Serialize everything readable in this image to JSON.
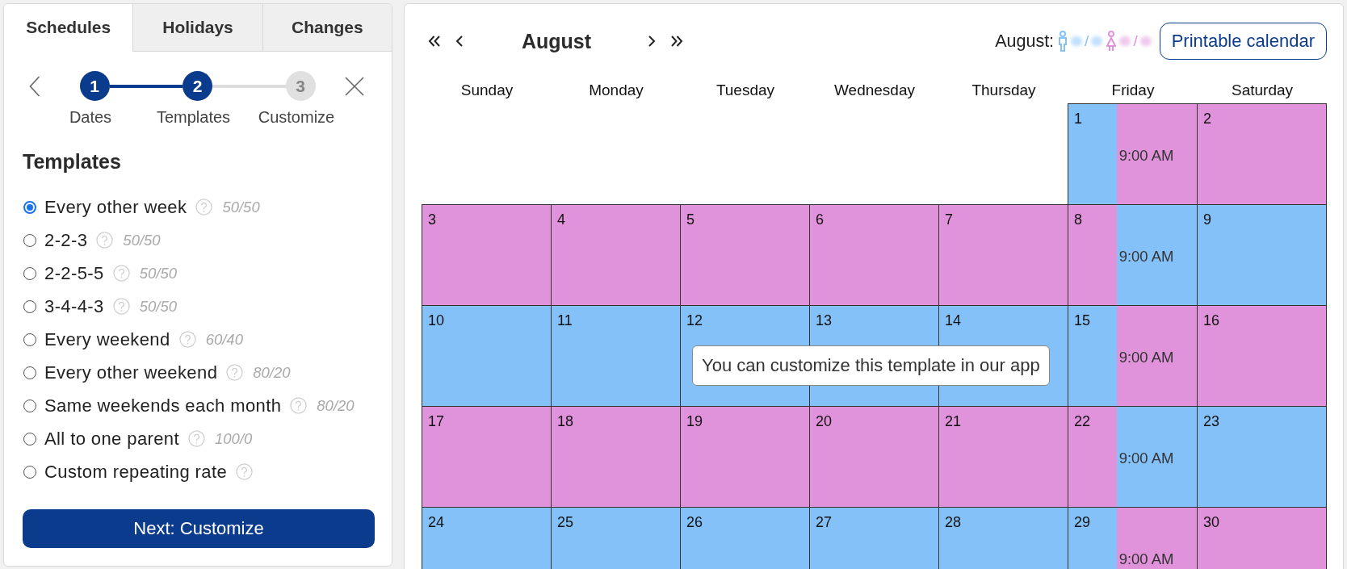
{
  "tabs": [
    {
      "label": "Schedules",
      "selected": true
    },
    {
      "label": "Holidays",
      "selected": false
    },
    {
      "label": "Changes",
      "selected": false
    }
  ],
  "stepper": {
    "steps": [
      {
        "number": "1",
        "label": "Dates",
        "reached": true
      },
      {
        "number": "2",
        "label": "Templates",
        "reached": true
      },
      {
        "number": "3",
        "label": "Customize",
        "reached": false
      }
    ]
  },
  "templates": {
    "title": "Templates",
    "options": [
      {
        "label": "Every other week",
        "ratio": "50/50",
        "selected": true
      },
      {
        "label": "2-2-3",
        "ratio": "50/50",
        "selected": false
      },
      {
        "label": "2-2-5-5",
        "ratio": "50/50",
        "selected": false
      },
      {
        "label": "3-4-4-3",
        "ratio": "50/50",
        "selected": false
      },
      {
        "label": "Every weekend",
        "ratio": "60/40",
        "selected": false
      },
      {
        "label": "Every other weekend",
        "ratio": "80/20",
        "selected": false
      },
      {
        "label": "Same weekends each month",
        "ratio": "80/20",
        "selected": false
      },
      {
        "label": "All to one parent",
        "ratio": "100/0",
        "selected": false
      },
      {
        "label": "Custom repeating rate",
        "selected": false
      }
    ]
  },
  "next_button": {
    "label": "Next: Customize"
  },
  "calendar": {
    "month": "August",
    "summary": {
      "label": "August:",
      "parents": [
        {
          "kind": "male",
          "color": "#85c1f9",
          "separator": "/"
        },
        {
          "kind": "female",
          "color": "#e093db",
          "separator": "/"
        }
      ]
    },
    "print_button": {
      "label": "Printable calendar"
    },
    "weekdays": [
      "Sunday",
      "Monday",
      "Tuesday",
      "Wednesday",
      "Thursday",
      "Friday",
      "Saturday"
    ],
    "weeks": [
      {
        "days": [
          {
            "kind": "blank"
          },
          {
            "kind": "blank"
          },
          {
            "kind": "blank"
          },
          {
            "kind": "blank"
          },
          {
            "kind": "blank"
          },
          {
            "kind": "handover",
            "date": "1",
            "parts": [
              {
                "color": "#85c1f9"
              },
              {
                "color": "#e093db",
                "time": "9:00 AM"
              }
            ]
          },
          {
            "kind": "day",
            "date": "2",
            "color": "#e093db"
          }
        ]
      },
      {
        "days": [
          {
            "kind": "day",
            "date": "3",
            "color": "#e093db"
          },
          {
            "kind": "day",
            "date": "4",
            "color": "#e093db"
          },
          {
            "kind": "day",
            "date": "5",
            "color": "#e093db"
          },
          {
            "kind": "day",
            "date": "6",
            "color": "#e093db"
          },
          {
            "kind": "day",
            "date": "7",
            "color": "#e093db"
          },
          {
            "kind": "handover",
            "date": "8",
            "parts": [
              {
                "color": "#e093db"
              },
              {
                "color": "#85c1f9",
                "time": "9:00 AM"
              }
            ]
          },
          {
            "kind": "day",
            "date": "9",
            "color": "#85c1f9"
          }
        ]
      },
      {
        "days": [
          {
            "kind": "day",
            "date": "10",
            "color": "#85c1f9"
          },
          {
            "kind": "day",
            "date": "11",
            "color": "#85c1f9"
          },
          {
            "kind": "day",
            "date": "12",
            "color": "#85c1f9"
          },
          {
            "kind": "day",
            "date": "13",
            "color": "#85c1f9"
          },
          {
            "kind": "day",
            "date": "14",
            "color": "#85c1f9"
          },
          {
            "kind": "handover",
            "date": "15",
            "parts": [
              {
                "color": "#85c1f9"
              },
              {
                "color": "#e093db",
                "time": "9:00 AM"
              }
            ]
          },
          {
            "kind": "day",
            "date": "16",
            "color": "#e093db"
          }
        ]
      },
      {
        "days": [
          {
            "kind": "day",
            "date": "17",
            "color": "#e093db"
          },
          {
            "kind": "day",
            "date": "18",
            "color": "#e093db"
          },
          {
            "kind": "day",
            "date": "19",
            "color": "#e093db"
          },
          {
            "kind": "day",
            "date": "20",
            "color": "#e093db"
          },
          {
            "kind": "day",
            "date": "21",
            "color": "#e093db"
          },
          {
            "kind": "handover",
            "date": "22",
            "parts": [
              {
                "color": "#e093db"
              },
              {
                "color": "#85c1f9",
                "time": "9:00 AM"
              }
            ]
          },
          {
            "kind": "day",
            "date": "23",
            "color": "#85c1f9"
          }
        ]
      },
      {
        "days": [
          {
            "kind": "day",
            "date": "24",
            "color": "#85c1f9"
          },
          {
            "kind": "day",
            "date": "25",
            "color": "#85c1f9"
          },
          {
            "kind": "day",
            "date": "26",
            "color": "#85c1f9"
          },
          {
            "kind": "day",
            "date": "27",
            "color": "#85c1f9"
          },
          {
            "kind": "day",
            "date": "28",
            "color": "#85c1f9"
          },
          {
            "kind": "handover",
            "date": "29",
            "parts": [
              {
                "color": "#85c1f9"
              },
              {
                "color": "#e093db",
                "time": "9:00 AM"
              }
            ]
          },
          {
            "kind": "day",
            "date": "30",
            "color": "#e093db"
          }
        ]
      }
    ],
    "tooltip": {
      "text": "You can customize this template in our app"
    }
  }
}
